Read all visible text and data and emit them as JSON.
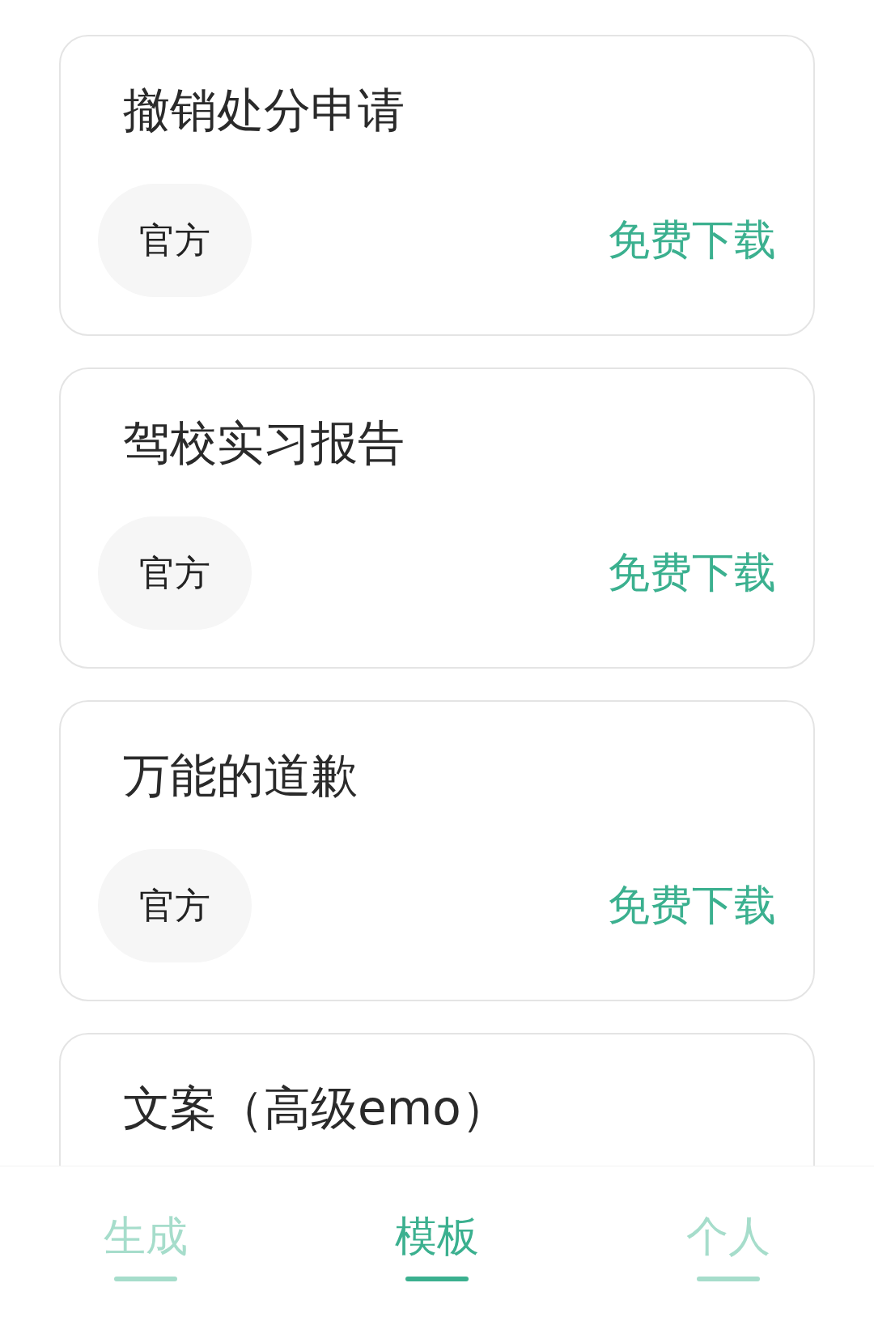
{
  "templates": [
    {
      "title": "撤销处分申请",
      "badge": "官方",
      "action": "免费下载"
    },
    {
      "title": "驾校实习报告",
      "badge": "官方",
      "action": "免费下载"
    },
    {
      "title": "万能的道歉",
      "badge": "官方",
      "action": "免费下载"
    },
    {
      "title": "文案（高级emo）"
    }
  ],
  "tabs": [
    {
      "label": "生成",
      "selected": false
    },
    {
      "label": "模板",
      "selected": true
    },
    {
      "label": "个人",
      "selected": false
    }
  ]
}
